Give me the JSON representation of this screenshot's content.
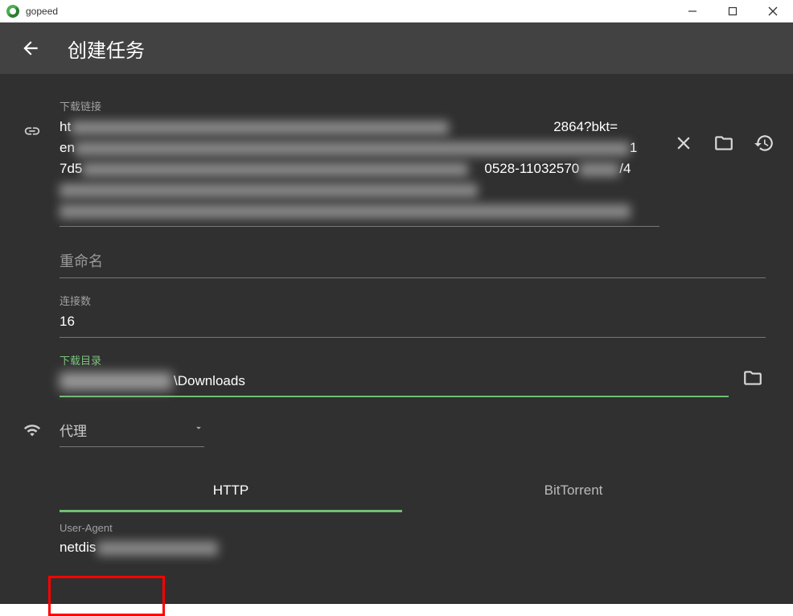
{
  "window": {
    "title": "gopeed"
  },
  "header": {
    "title": "创建任务"
  },
  "fields": {
    "download_link": {
      "label": "下载链接",
      "visible_fragments": {
        "line1_start": "ht",
        "line1_end": "2864?bkt=",
        "line2_start": "en",
        "line2_end": "1",
        "line3_start": "7d5",
        "line3_mid": "0528-11032570",
        "line3_end": "/4"
      }
    },
    "rename": {
      "label": "重命名",
      "value": ""
    },
    "connections": {
      "label": "连接数",
      "value": "16"
    },
    "download_dir": {
      "label": "下载目录",
      "value_visible_suffix": "\\Downloads"
    },
    "proxy": {
      "label": "代理"
    },
    "user_agent": {
      "label": "User-Agent",
      "value_visible_prefix": "netdis"
    }
  },
  "tabs": {
    "http": "HTTP",
    "bittorrent": "BitTorrent",
    "active": "http"
  }
}
